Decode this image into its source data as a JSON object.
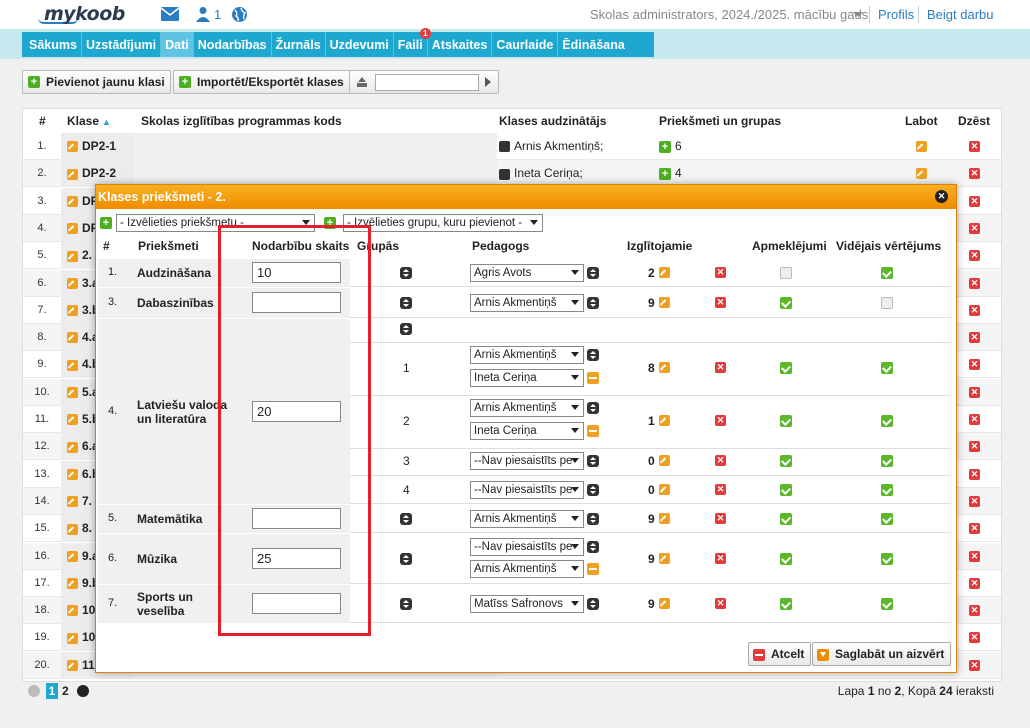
{
  "app": {
    "logo_text": "mykoob",
    "user_count": "1"
  },
  "header": {
    "school": "Skolas administrators, 2024./2025. mācību gads",
    "profile": "Profils",
    "logout": "Beigt darbu"
  },
  "nav": {
    "items": [
      "Sākums",
      "Uzstādījumi",
      "Dati",
      "Nodarbības",
      "Žurnāls",
      "Uzdevumi",
      "Faili",
      "Atskaites",
      "Caurlaide",
      "Ēdināšana"
    ],
    "active_index": 2,
    "faili_badge": "1"
  },
  "toolbar": {
    "add_class": "Pievienot jaunu klasi",
    "import_export": "Importēt/Eksportēt klases"
  },
  "table": {
    "headers": {
      "num": "#",
      "class": "Klase",
      "program": "Skolas izglītības programmas kods",
      "teacher": "Klases audzinātājs",
      "subjects": "Priekšmeti un grupas",
      "edit": "Labot",
      "delete": "Dzēst"
    },
    "rows": [
      {
        "num": "1.",
        "class": "DP2-1",
        "teacher": "Arnis Akmentiņš;",
        "subjects": "6"
      },
      {
        "num": "2.",
        "class": "DP2-2",
        "teacher": "Ineta Ceriņa;",
        "subjects": "4"
      },
      {
        "num": "3.",
        "class": "DP"
      },
      {
        "num": "4.",
        "class": "DP"
      },
      {
        "num": "5.",
        "class": "2."
      },
      {
        "num": "6.",
        "class": "3.a"
      },
      {
        "num": "7.",
        "class": "3.b"
      },
      {
        "num": "8.",
        "class": "4.a"
      },
      {
        "num": "9.",
        "class": "4.b"
      },
      {
        "num": "10.",
        "class": "5.a"
      },
      {
        "num": "11.",
        "class": "5.b"
      },
      {
        "num": "12.",
        "class": "6.a"
      },
      {
        "num": "13.",
        "class": "6.b"
      },
      {
        "num": "14.",
        "class": "7."
      },
      {
        "num": "15.",
        "class": "8."
      },
      {
        "num": "16.",
        "class": "9.a"
      },
      {
        "num": "17.",
        "class": "9.b"
      },
      {
        "num": "18.",
        "class": "10"
      },
      {
        "num": "19.",
        "class": "10"
      },
      {
        "num": "20.",
        "class": "11"
      }
    ]
  },
  "pager": {
    "pages": [
      "1",
      "2"
    ],
    "current": "1",
    "summary_prefix": "Lapa",
    "page": "1",
    "of": "no",
    "total_pages": "2",
    "total_label": ", Kopā",
    "total": "24",
    "records": "ieraksti"
  },
  "modal": {
    "title": "Klases priekšmeti - 2.",
    "subject_select": "- Izvēlieties priekšmetu -",
    "group_select": "- Izvēlieties grupu, kuru pievienot -",
    "headers": {
      "num": "#",
      "subject": "Priekšmeti",
      "lesson_count": "Nodarbību skaits",
      "groups": "Grupās",
      "teacher": "Pedagogs",
      "students": "Izglītojamie",
      "attendance": "Apmeklējumi",
      "average": "Vidējais vērtējums"
    },
    "subjects": [
      {
        "num": "1.",
        "name": "Audzināšana",
        "lessons": "10",
        "teachers": [
          "Agris Avots"
        ],
        "students": "2",
        "attendance": false,
        "average": true
      },
      {
        "num": "3.",
        "name": "Dabaszinības",
        "lessons": "",
        "teachers": [
          "Arnis Akmentiņš"
        ],
        "students": "9",
        "attendance": true,
        "average": false
      },
      {
        "num": "4.",
        "name": "Latviešu valoda un literatūra",
        "lessons": "20",
        "groups": [
          {
            "label": "1",
            "teachers": [
              "Arnis Akmentiņš",
              "Ineta Ceriņa"
            ],
            "students": "8",
            "attendance": true,
            "average": true
          },
          {
            "label": "2",
            "teachers": [
              "Arnis Akmentiņš",
              "Ineta Ceriņa"
            ],
            "students": "1",
            "attendance": true,
            "average": true
          },
          {
            "label": "3",
            "teachers": [
              "--Nav piesaistīts pe"
            ],
            "students": "0",
            "attendance": true,
            "average": true
          },
          {
            "label": "4",
            "teachers": [
              "--Nav piesaistīts pe"
            ],
            "students": "0",
            "attendance": true,
            "average": true
          }
        ]
      },
      {
        "num": "5.",
        "name": "Matemātika",
        "lessons": "",
        "teachers": [
          "Arnis Akmentiņš"
        ],
        "students": "9",
        "attendance": true,
        "average": true
      },
      {
        "num": "6.",
        "name": "Mūzika",
        "lessons": "25",
        "teachers": [
          "--Nav piesaistīts pe",
          "Arnis Akmentiņš"
        ],
        "students": "9",
        "attendance": true,
        "average": true
      },
      {
        "num": "7.",
        "name": "Sports un veselība",
        "lessons": "",
        "teachers": [
          "Matīss Safronovs"
        ],
        "students": "9",
        "attendance": true,
        "average": true
      }
    ],
    "cancel": "Atcelt",
    "save": "Saglabāt un aizvērt"
  }
}
